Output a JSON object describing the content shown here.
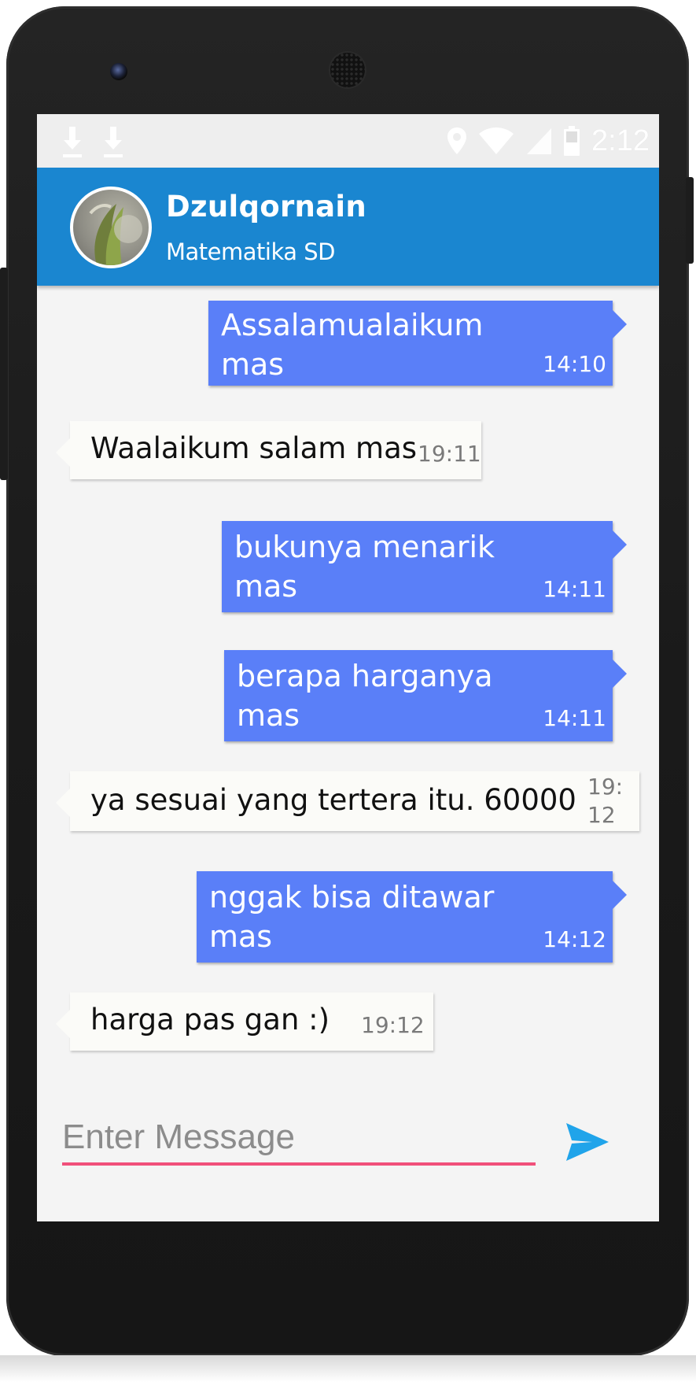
{
  "status_bar": {
    "time": "2:12",
    "icons": [
      "download-icon",
      "download-icon",
      "location-icon",
      "wifi-icon",
      "signal-icon",
      "battery-icon"
    ]
  },
  "header": {
    "name": "Dzulqornain",
    "subtitle": "Matematika SD",
    "color": "#1a86d0"
  },
  "colors": {
    "sent_bubble": "#5a7ff8",
    "received_bubble": "#fbfbf8",
    "input_underline": "#f0507a",
    "send_icon": "#20a4ea"
  },
  "messages": [
    {
      "type": "sent",
      "text": "Assalamualaikum\nmas",
      "time": "14:10"
    },
    {
      "type": "received",
      "text": "Waalaikum salam mas",
      "time": "19:11"
    },
    {
      "type": "sent",
      "text": "bukunya menarik\nmas",
      "time": "14:11"
    },
    {
      "type": "sent",
      "text": "berapa harganya\nmas",
      "time": "14:11"
    },
    {
      "type": "received",
      "text": "ya sesuai yang tertera itu. 60000",
      "time": "19:\n12"
    },
    {
      "type": "sent",
      "text": "nggak bisa ditawar\nmas",
      "time": "14:12"
    },
    {
      "type": "received",
      "text": "harga pas gan :)",
      "time": "19:12"
    }
  ],
  "composer": {
    "placeholder": "Enter Message",
    "value": "",
    "send_icon": "send-icon"
  }
}
